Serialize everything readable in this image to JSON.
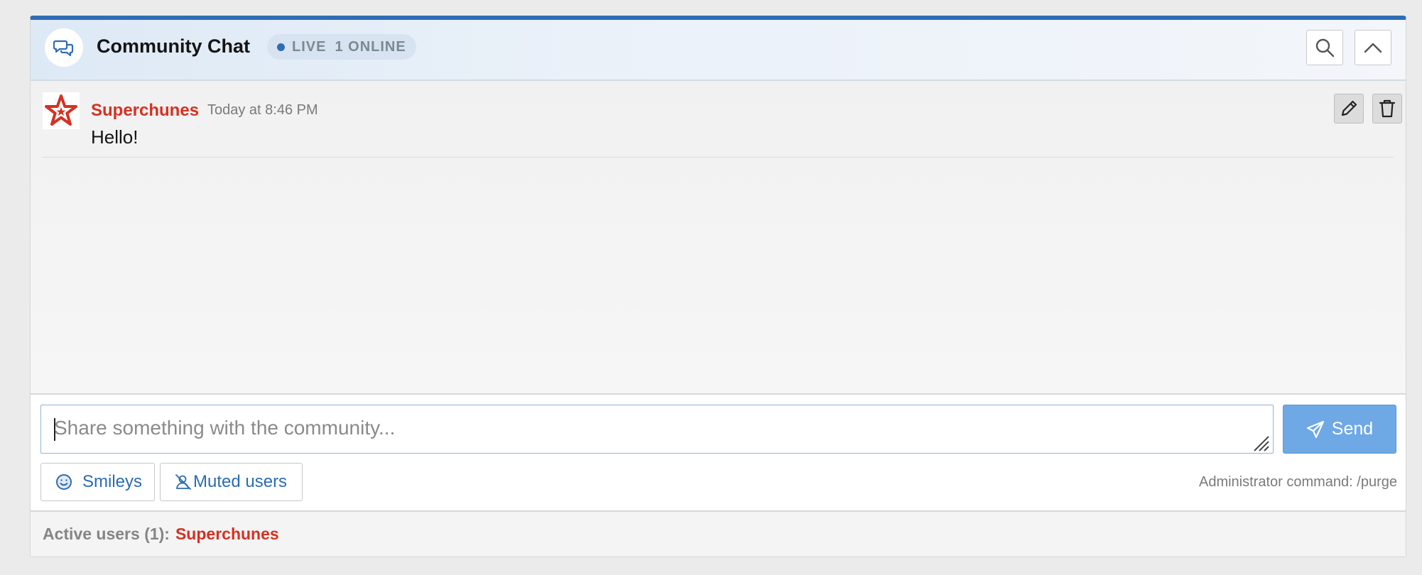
{
  "header": {
    "title": "Community Chat",
    "live_label": "LIVE",
    "online_label": "1 ONLINE",
    "accent_color": "#2f6db4"
  },
  "messages": [
    {
      "username": "Superchunes",
      "timestamp": "Today at 8:46 PM",
      "text": "Hello!",
      "username_color": "#d53122",
      "avatar_icon": "star-icon"
    }
  ],
  "composer": {
    "placeholder": "Share something with the community...",
    "send_label": "Send",
    "smileys_label": "Smileys",
    "muted_label": "Muted users",
    "admin_command": "Administrator command: /purge"
  },
  "footer": {
    "active_label": "Active users (1):",
    "active_user": "Superchunes"
  }
}
